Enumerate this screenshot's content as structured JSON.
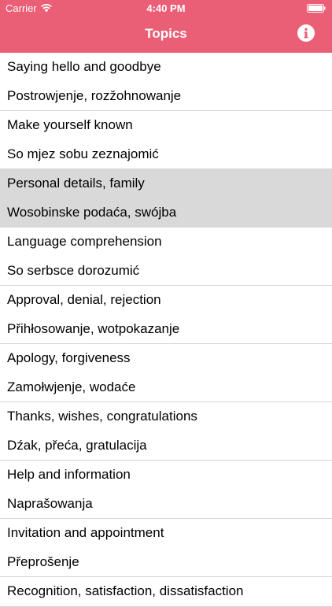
{
  "status_bar": {
    "carrier": "Carrier",
    "time": "4:40 PM",
    "wifi_icon": "wifi-icon",
    "battery_icon": "battery-icon"
  },
  "nav": {
    "title": "Topics",
    "info_icon": "info-icon",
    "bar_color": "#ea5e76"
  },
  "topics": [
    {
      "english": "Saying hello and goodbye",
      "sorbian": "Postrowjenje, rozžohnowanje",
      "selected": false
    },
    {
      "english": "Make yourself known",
      "sorbian": "So mjez sobu zeznajomić",
      "selected": false
    },
    {
      "english": "Personal details, family",
      "sorbian": "Wosobinske podaća, swójba",
      "selected": true
    },
    {
      "english": "Language comprehension",
      "sorbian": "So serbsce dorozumić",
      "selected": false
    },
    {
      "english": "Approval, denial, rejection",
      "sorbian": "Přihłosowanje, wotpokazanje",
      "selected": false
    },
    {
      "english": "Apology, forgiveness",
      "sorbian": "Zamołwjenje, wodaće",
      "selected": false
    },
    {
      "english": "Thanks, wishes, congratulations",
      "sorbian": "Dźak, přeća, gratulacija",
      "selected": false
    },
    {
      "english": "Help and information",
      "sorbian": "Naprašowanja",
      "selected": false
    },
    {
      "english": "Invitation and appointment",
      "sorbian": "Přeprošenje",
      "selected": false
    },
    {
      "english": "Recognition, satisfaction, dissatisfaction",
      "sorbian": "",
      "selected": false
    }
  ]
}
